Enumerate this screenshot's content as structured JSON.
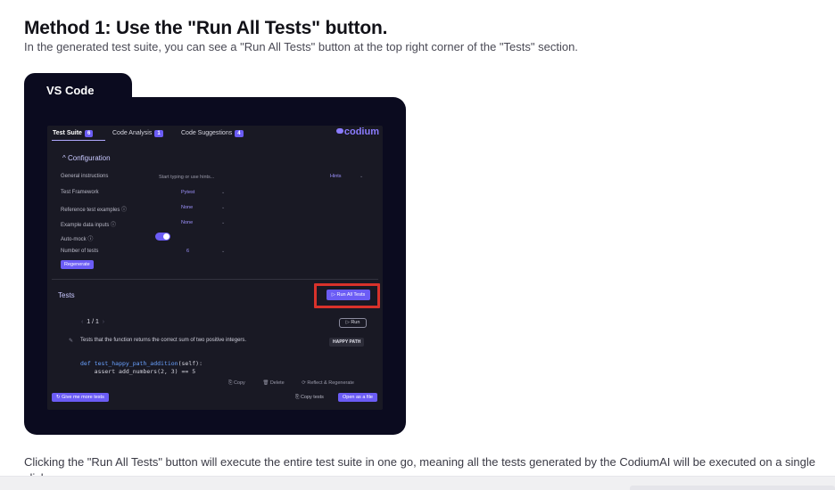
{
  "article": {
    "heading": "Method 1: Use the \"Run All Tests\" button.",
    "intro": "In the generated test suite, you can see a \"Run All Tests\" button at the top right corner of the \"Tests\" section.",
    "body": "Clicking the \"Run All Tests\" button will execute the entire test suite in one go, meaning all the tests generated by the CodiumAI will be executed on a single click."
  },
  "frame": {
    "tab_label": "VS Code"
  },
  "panel": {
    "tabs": [
      {
        "label": "Test Suite",
        "count": "6"
      },
      {
        "label": "Code Analysis",
        "count": "1"
      },
      {
        "label": "Code Suggestions",
        "count": "4"
      }
    ],
    "logo": "codium",
    "configuration": {
      "title": "Configuration",
      "general_instructions_label": "General instructions",
      "general_instructions_placeholder": "Start typing or use hints...",
      "hints_label": "Hints",
      "rows": [
        {
          "label": "Test Framework",
          "value": "Pytest"
        },
        {
          "label": "Reference test examples ⓘ",
          "value": "None"
        },
        {
          "label": "Example data inputs ⓘ",
          "value": "None"
        },
        {
          "label": "Auto-mock ⓘ",
          "value": ""
        },
        {
          "label": "Number of tests",
          "value": "6"
        }
      ],
      "auto_mock_on": true,
      "regenerate_label": "Regenerate"
    },
    "tests": {
      "title": "Tests",
      "run_all_label": "Run All Tests",
      "pager": "1 / 1",
      "run_label": "Run",
      "description": "Tests that the function returns the correct sum of two positive integers.",
      "tag": "HAPPY PATH",
      "code_line1_kw": "def",
      "code_line1_fn": "test_happy_path_addition",
      "code_line1_rest": "(self):",
      "code_line2": "assert add_numbers(2, 3) == 5",
      "actions": [
        "Copy",
        "Delete",
        "Reflect & Regenerate"
      ]
    },
    "footer": {
      "more_tests_label": "Give me more tests",
      "copy_tests_label": "Copy tests",
      "open_file_label": "Open as a file"
    }
  },
  "colors": {
    "accent": "#6b5cf5",
    "frame": "#0b0b1f",
    "highlight": "#d8322b"
  }
}
